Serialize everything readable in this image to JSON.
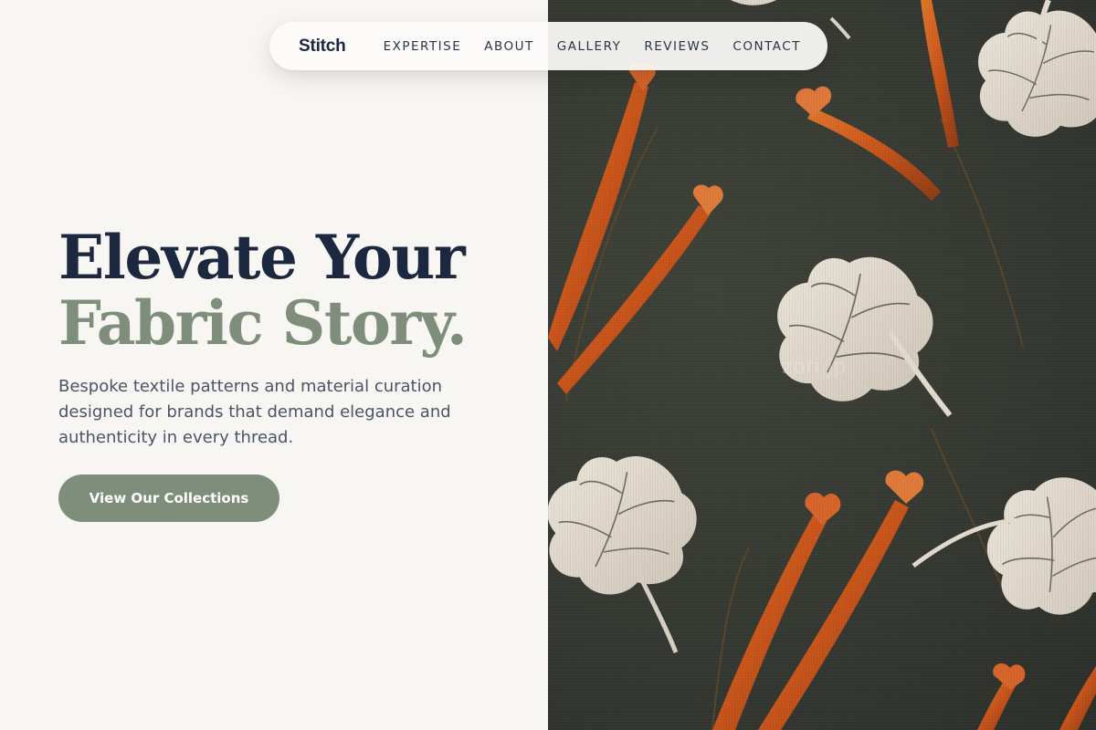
{
  "nav": {
    "brand": "Stitch",
    "links": [
      "EXPERTISE",
      "ABOUT",
      "GALLERY",
      "REVIEWS",
      "CONTACT"
    ]
  },
  "hero": {
    "title_line1": "Elevate Your",
    "title_line2": "Fabric Story.",
    "subtitle": "Bespoke textile patterns and material curation designed for brands that demand elegance and authenticity in every thread.",
    "cta_label": "View Our Collections"
  },
  "image": {
    "description": "Dark olive fabric with pale leaves and orange stamen-like flower motifs",
    "watermark": "zori.jp"
  },
  "colors": {
    "background": "#f8f6f3",
    "navy": "#1c2840",
    "sage": "#7e8e7b",
    "fabric": "#363a32",
    "leaf": "#e4dcd0",
    "orange": "#d5641e"
  }
}
